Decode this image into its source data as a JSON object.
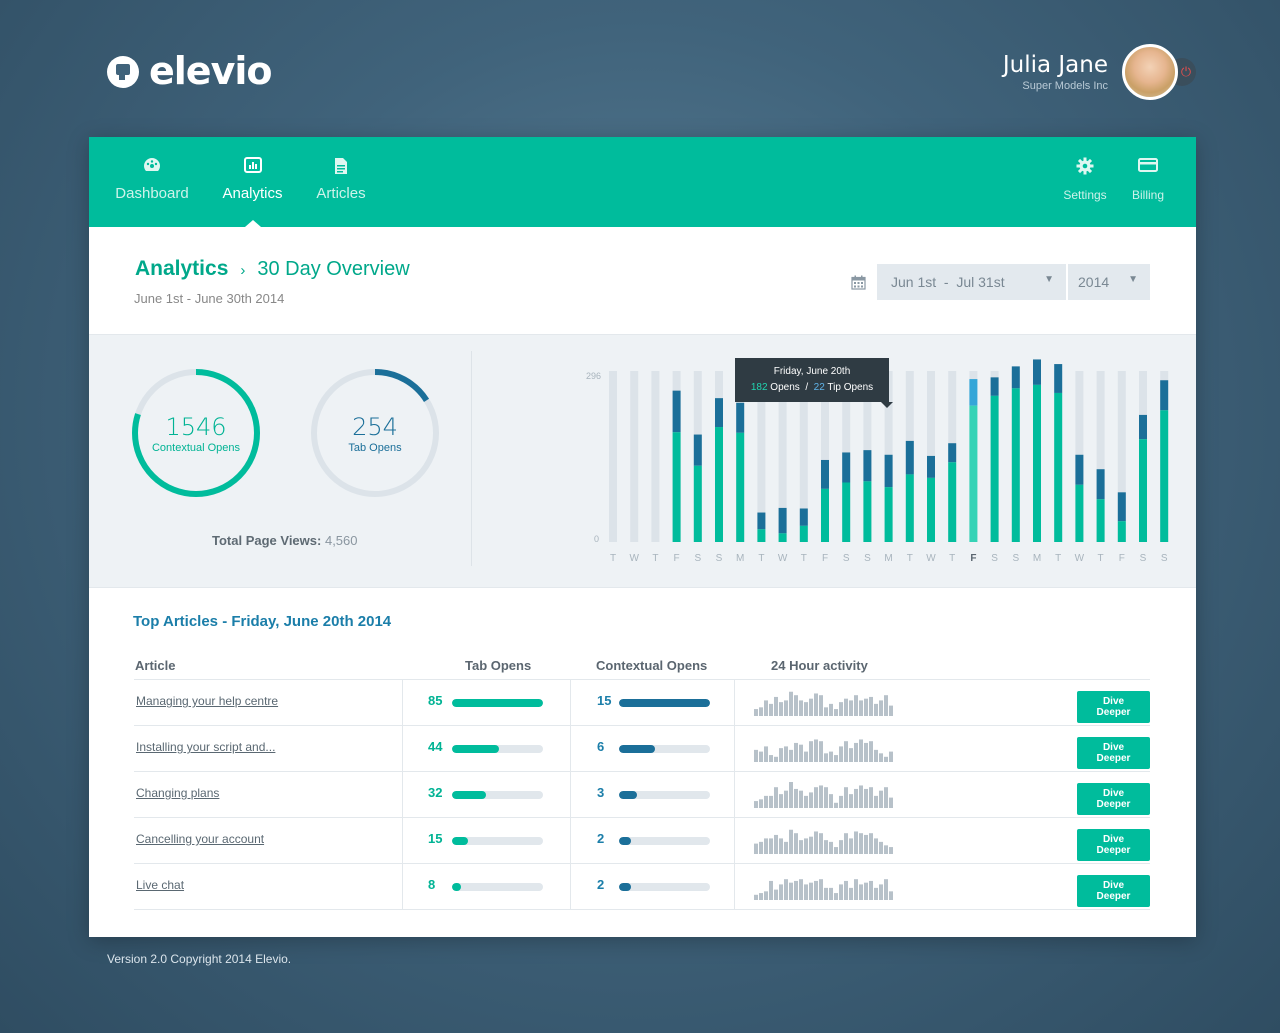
{
  "brand": {
    "name": "elevio"
  },
  "user": {
    "name": "Julia Jane",
    "company": "Super Models Inc"
  },
  "nav": {
    "items": [
      {
        "label": "Dashboard",
        "icon": "palette-icon"
      },
      {
        "label": "Analytics",
        "icon": "bar-chart-icon",
        "active": true
      },
      {
        "label": "Articles",
        "icon": "document-icon"
      }
    ],
    "right_items": [
      {
        "label": "Settings",
        "icon": "gear-icon"
      },
      {
        "label": "Billing",
        "icon": "credit-card-icon"
      }
    ]
  },
  "header": {
    "section": "Analytics",
    "separator": "›",
    "title": "30 Day Overview",
    "date_range": "June 1st - June 30th 2014",
    "range_select": "Jun 1st  -  Jul 31st",
    "year_select": "2014"
  },
  "stats": {
    "contextual_opens": {
      "value": "1546",
      "label": "Contextual Opens",
      "fraction": 0.8
    },
    "tab_opens": {
      "value": "254",
      "label": "Tab Opens",
      "fraction": 0.16
    },
    "total_page_views_label": "Total Page Views:",
    "total_page_views_value": "4,560"
  },
  "tooltip": {
    "date": "Friday, June 20th",
    "opens": "182",
    "opens_label": "Opens",
    "divider": "/",
    "tip_opens": "22",
    "tip_opens_label": "Tip Opens"
  },
  "chart_data": {
    "type": "bar",
    "stacked": true,
    "ylim": [
      0,
      296
    ],
    "ytick_labels": [
      "296",
      "0"
    ],
    "categories": [
      "T",
      "W",
      "T",
      "F",
      "S",
      "S",
      "M",
      "T",
      "W",
      "T",
      "F",
      "S",
      "S",
      "M",
      "T",
      "W",
      "T",
      "F",
      "S",
      "S",
      "M",
      "T",
      "W",
      "T",
      "F",
      "S",
      "S",
      "M",
      "T",
      "W"
    ],
    "highlight_index": 17,
    "series": [
      {
        "values": [
          0,
          0,
          0,
          190,
          132,
          199,
          189,
          22,
          15,
          28,
          92,
          103,
          105,
          95,
          117,
          111,
          138,
          236,
          253,
          266,
          272,
          258,
          99,
          74,
          36,
          178,
          228,
          266,
          272,
          242
        ]
      },
      {
        "values": [
          0,
          0,
          0,
          72,
          54,
          50,
          52,
          29,
          44,
          30,
          50,
          52,
          54,
          56,
          58,
          38,
          33,
          46,
          32,
          38,
          44,
          50,
          52,
          52,
          50,
          42,
          52,
          54,
          42,
          54
        ]
      }
    ],
    "colors": {
      "contextual": "#00bc9c",
      "tab": "#1b6f99",
      "track": "#dce3e9",
      "highlight_contextual": "#35d3b6",
      "highlight_tab": "#34a6d8"
    }
  },
  "articles": {
    "title_prefix": "Top Articles",
    "title_suffix": "- Friday, June 20th 2014",
    "columns": {
      "article": "Article",
      "tab_opens": "Tab Opens",
      "contextual_opens": "Contextual Opens",
      "activity": "24 Hour activity"
    },
    "max_tab": 85,
    "max_ctx": 15,
    "action_label": "Dive Deeper",
    "rows": [
      {
        "name": "Managing your help centre",
        "tab_opens": 85,
        "contextual_opens": 15,
        "activity": [
          4,
          5,
          9,
          7,
          11,
          8,
          9,
          14,
          12,
          9,
          8,
          10,
          13,
          12,
          5,
          7,
          4,
          8,
          10,
          9,
          12,
          9,
          10,
          11,
          7,
          9,
          12,
          6
        ]
      },
      {
        "name": "Installing your script and...",
        "tab_opens": 44,
        "contextual_opens": 6,
        "activity": [
          7,
          6,
          9,
          4,
          3,
          8,
          9,
          7,
          11,
          10,
          6,
          12,
          13,
          12,
          5,
          6,
          4,
          9,
          12,
          8,
          11,
          13,
          11,
          12,
          7,
          5,
          3,
          6
        ]
      },
      {
        "name": "Changing plans",
        "tab_opens": 32,
        "contextual_opens": 3,
        "activity": [
          4,
          5,
          7,
          7,
          12,
          8,
          10,
          15,
          11,
          10,
          7,
          9,
          12,
          13,
          12,
          8,
          3,
          7,
          12,
          8,
          11,
          13,
          11,
          12,
          7,
          10,
          12,
          6
        ]
      },
      {
        "name": "Cancelling your account",
        "tab_opens": 15,
        "contextual_opens": 2,
        "activity": [
          6,
          7,
          9,
          9,
          11,
          9,
          7,
          14,
          12,
          8,
          9,
          10,
          13,
          12,
          8,
          7,
          4,
          8,
          12,
          9,
          13,
          12,
          11,
          12,
          9,
          7,
          5,
          4
        ]
      },
      {
        "name": "Live chat",
        "tab_opens": 8,
        "contextual_opens": 2,
        "activity": [
          3,
          4,
          5,
          11,
          6,
          9,
          12,
          10,
          11,
          12,
          9,
          10,
          11,
          12,
          7,
          7,
          4,
          9,
          11,
          7,
          12,
          9,
          10,
          11,
          7,
          9,
          12,
          5
        ]
      }
    ]
  },
  "footer": {
    "text": "Version 2.0 Copyright 2014 Elevio."
  }
}
